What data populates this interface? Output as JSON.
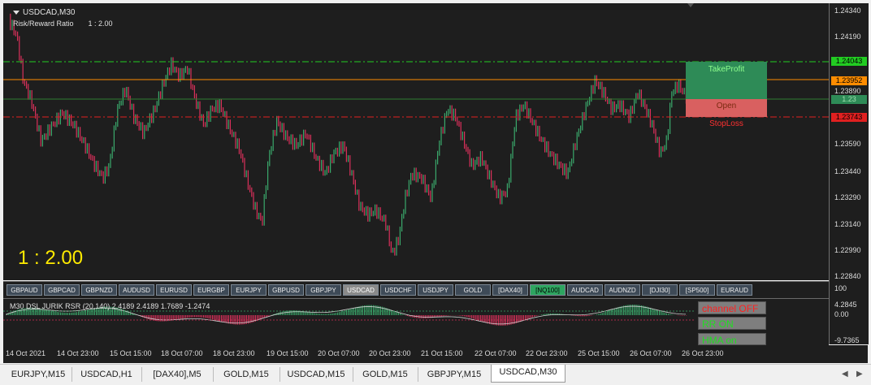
{
  "chart": {
    "title": "USDCAD,M30",
    "rr_label": "Risk/Reward Ratio",
    "rr_value": "1 : 2.00",
    "big_ratio": "1 : 2.00",
    "take_profit_label": "TakeProfit",
    "open_label": "Open",
    "stop_loss_label": "StopLoss",
    "colors": {
      "bull": "#3aa86b",
      "bear": "#d9305a",
      "tp_line": "#22cc22",
      "entry_line": "#ff8c00",
      "sl_line": "#e02020",
      "tp_box": "#2e8b57",
      "sl_box": "#d96060"
    }
  },
  "price_axis": {
    "ticks": [
      "1.24340",
      "1.24190",
      "1.23890",
      "1.23740",
      "1.23590",
      "1.23440",
      "1.23290",
      "1.23140",
      "1.22990",
      "1.22840"
    ],
    "tags": {
      "take_profit": "1.24043",
      "entry": "1.23952",
      "open": "1.23",
      "stop_loss": "1.23743"
    }
  },
  "symbol_buttons": [
    "GBPAUD",
    "GBPCAD",
    "GBPNZD",
    "AUDUSD",
    "EURUSD",
    "EURGBP",
    "EURJPY",
    "GBPUSD",
    "GBPJPY",
    "USDCAD",
    "USDCHF",
    "USDJPY",
    "GOLD",
    "[DAX40]",
    "[NQ100]",
    "AUDCAD",
    "AUDNZD",
    "[DJI30]",
    "[SP500]",
    "EURAUD"
  ],
  "selected_symbol": "USDCAD",
  "highlighted_symbol": "[NQ100]",
  "indicator": {
    "title": "M30 DSL JURIK RSR (20,140) 2.4189 2.4189 1.7689 -1.2474",
    "axis_ticks": [
      "100",
      "4.2845",
      "0.00",
      "-9.7365"
    ],
    "buttons": [
      {
        "label": "channel OFF",
        "color": "#ff2020"
      },
      {
        "label": "RR ON",
        "color": "#22dd22"
      },
      {
        "label": "HMA on",
        "color": "#22dd22"
      }
    ]
  },
  "time_axis": [
    "14 Oct 2021",
    "14 Oct 23:00",
    "15 Oct 15:00",
    "18 Oct 07:00",
    "18 Oct 23:00",
    "19 Oct 15:00",
    "20 Oct 07:00",
    "20 Oct 23:00",
    "21 Oct 15:00",
    "22 Oct 07:00",
    "22 Oct 23:00",
    "25 Oct 15:00",
    "26 Oct 07:00",
    "26 Oct 23:00"
  ],
  "tabs": [
    "EURJPY,M15",
    "USDCAD,H1",
    "[DAX40],M5",
    "GOLD,M15",
    "USDCAD,M15",
    "GOLD,M15",
    "GBPJPY,M15",
    "USDCAD,M30"
  ],
  "active_tab": "USDCAD,M30"
}
